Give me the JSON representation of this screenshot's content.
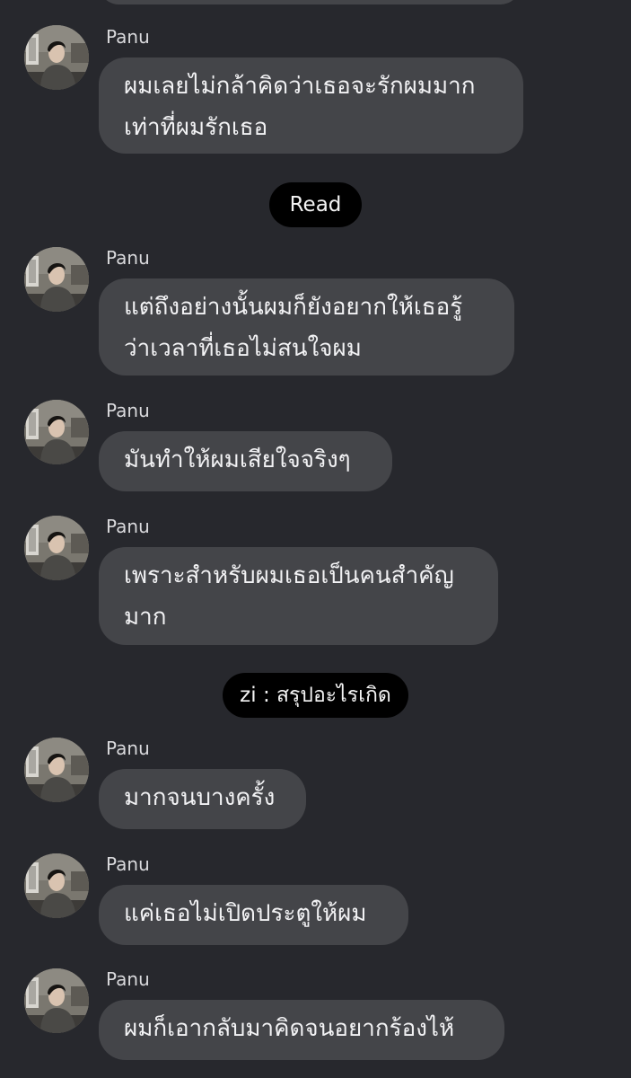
{
  "sender_name": "Panu",
  "dividers": {
    "read": "Read",
    "zi": "zi : สรุปอะไรเกิด"
  },
  "messages": [
    {
      "lines": [
        "ผมเลยไม่กล้าคิดว่าเธอจะรักผมมาก",
        "เท่าที่ผมรักเธอ"
      ]
    },
    {
      "lines": [
        "แต่ถึงอย่างนั้นผมก็ยังอยากให้เธอรู้",
        "ว่าเวลาที่เธอไม่สนใจผม"
      ]
    },
    {
      "lines": [
        "มันทำให้ผมเสียใจจริงๆ"
      ]
    },
    {
      "lines": [
        "เพราะสำหรับผมเธอเป็นคนสำคัญ",
        "มาก"
      ]
    },
    {
      "lines": [
        "มากจนบางครั้ง"
      ]
    },
    {
      "lines": [
        "แค่เธอไม่เปิดประตูให้ผม"
      ]
    },
    {
      "lines": [
        "ผมก็เอากลับมาคิดจนอยากร้องไห้"
      ]
    }
  ]
}
